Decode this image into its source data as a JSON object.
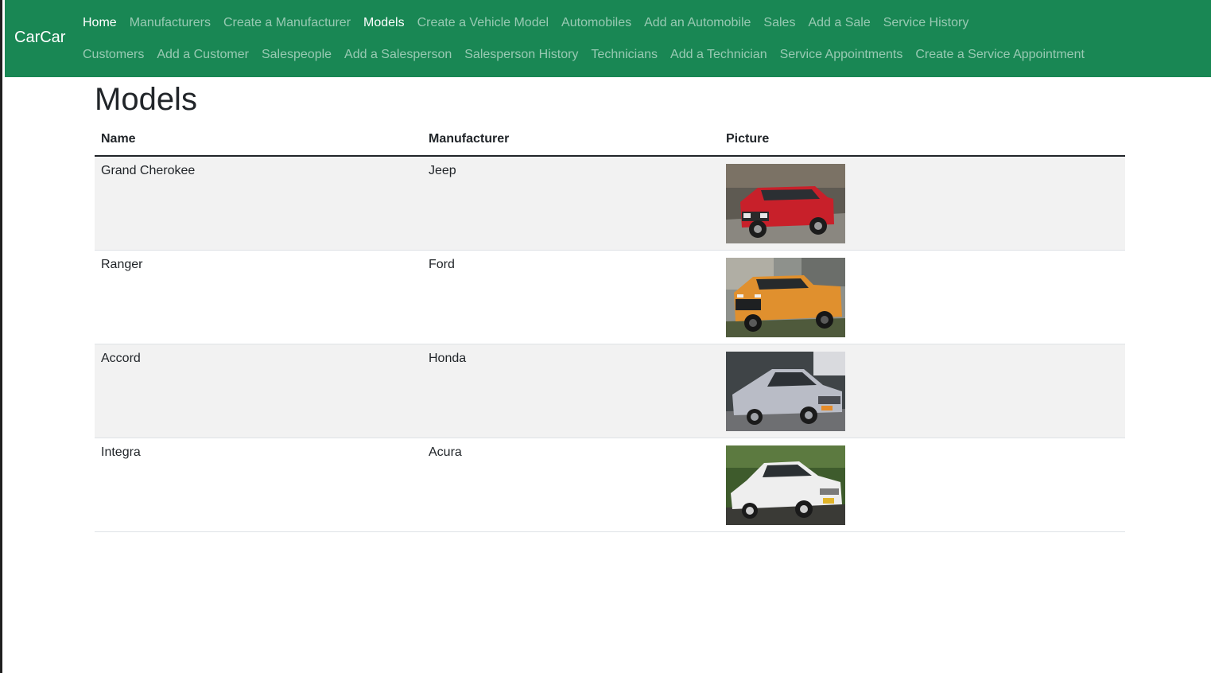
{
  "brand": "CarCar",
  "nav": {
    "row1": [
      {
        "label": "Home",
        "active": true
      },
      {
        "label": "Manufacturers",
        "active": false
      },
      {
        "label": "Create a Manufacturer",
        "active": false
      },
      {
        "label": "Models",
        "active": true
      },
      {
        "label": "Create a Vehicle Model",
        "active": false
      },
      {
        "label": "Automobiles",
        "active": false
      },
      {
        "label": "Add an Automobile",
        "active": false
      },
      {
        "label": "Sales",
        "active": false
      },
      {
        "label": "Add a Sale",
        "active": false
      },
      {
        "label": "Service History",
        "active": false
      }
    ],
    "row2": [
      {
        "label": "Customers",
        "active": false
      },
      {
        "label": "Add a Customer",
        "active": false
      },
      {
        "label": "Salespeople",
        "active": false
      },
      {
        "label": "Add a Salesperson",
        "active": false
      },
      {
        "label": "Salesperson History",
        "active": false
      },
      {
        "label": "Technicians",
        "active": false
      },
      {
        "label": "Add a Technician",
        "active": false
      },
      {
        "label": "Service Appointments",
        "active": false
      },
      {
        "label": "Create a Service Appointment",
        "active": false
      }
    ]
  },
  "page": {
    "title": "Models",
    "columns": [
      "Name",
      "Manufacturer",
      "Picture"
    ],
    "rows": [
      {
        "name": "Grand Cherokee",
        "manufacturer": "Jeep",
        "picture": "red-jeep-suv-photo",
        "color": "#c8202a"
      },
      {
        "name": "Ranger",
        "manufacturer": "Ford",
        "picture": "orange-ford-pickup-photo",
        "color": "#e0902e"
      },
      {
        "name": "Accord",
        "manufacturer": "Honda",
        "picture": "silver-honda-sedan-photo",
        "color": "#b9bcc6"
      },
      {
        "name": "Integra",
        "manufacturer": "Acura",
        "picture": "white-acura-coupe-photo",
        "color": "#eeeeee"
      }
    ]
  },
  "colors": {
    "navbar": "#198754",
    "stripe": "#f2f2f2",
    "text": "#212529"
  }
}
